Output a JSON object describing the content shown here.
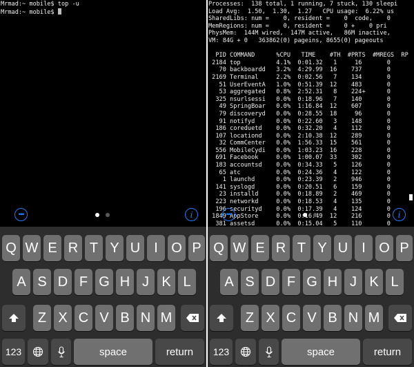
{
  "left": {
    "lines": [
      "Mrmad:~ mobile$ top -u",
      "Mrmad:~ mobile$ "
    ]
  },
  "right": {
    "header": [
      "Processes:  138 total, 1 running, 7 stuck, 130 sleepi",
      "Load Avg:  1.50,  1.30,  1.27   CPU usage:  6.22% us",
      "SharedLibs: num =    0, resident =    0  code,    0",
      "MemRegions: num =    0, resident =    0 +    0 pri",
      "PhysMem:  144M wired,  147M active,   86M inactive,",
      "VM: 84G + 0   363862(0) pageins, 8655(0) pageouts"
    ],
    "table_header": "  PID COMMAND      %CPU   TIME    #TH  #PRTS  #MREGS  RP",
    "rows": [
      " 2184 top          4.1%  0:01.32   1     16       0",
      "   70 backboardd   3.2%  4:29.99  16    737       0",
      " 2169 Terminal     2.2%  0:02.56   7    134       0",
      "   51 UserEventA   1.0%  0:51.39  12    483       0",
      "   53 aggregated   0.8%  2:52.31   8    224+      0",
      "  325 nsurlsessi   0.0%  0:18.96   7    140       0",
      "   49 SpringBoar   0.0%  1:16.84  12    607       0",
      "   79 discoveryd   0.0%  0:28.55  18     96       0",
      "   91 notifyd      0.0%  0:22.60   3    148       0",
      "  186 coreduetd    0.0%  0:32.20   4    112       0",
      "  107 locationd    0.0%  2:10.38  12    289       0",
      "   32 CommCenter   0.0%  1:56.33  15    561       0",
      "  556 MobileCydi   0.0%  1:03.23  16    228       0",
      "  691 Facebook     0.0%  1:00.07  33    302       0",
      "  183 accountsd    0.0%  0:34.33   5    126       0",
      "   65 atc          0.0%  0:24.36   4    122       0",
      "    1 launchd      0.0%  0:23.39   2    946       0",
      "  141 syslogd      0.0%  0:20.51   6    159       0",
      "   23 installd     0.0%  0:18.89   2    469       0",
      "  223 networkd     0.0%  0:18.53   4    135       0",
      "  196 securityd    0.0%  0:17.39   4    124       0",
      " 1849 AppStore     0.0%  0:16.49  12    216       0",
      "  381 assetsd      0.0%  0:15.04   5    110       0"
    ]
  },
  "toolbar": {
    "keyboard_icon": "keyboard-icon",
    "info_label": "i",
    "info_icon": "info-icon"
  },
  "page_indicator": {
    "pages": 2,
    "current": 1
  },
  "keyboard": {
    "row1": [
      "Q",
      "W",
      "E",
      "R",
      "T",
      "Y",
      "U",
      "I",
      "O",
      "P"
    ],
    "row2": [
      "A",
      "S",
      "D",
      "F",
      "G",
      "H",
      "J",
      "K",
      "L"
    ],
    "row3": [
      "Z",
      "X",
      "C",
      "V",
      "B",
      "N",
      "M"
    ],
    "shift_icon": "shift-icon",
    "delete_icon": "delete-icon",
    "numbers_label": "123",
    "globe_icon": "globe-icon",
    "mic_icon": "microphone-icon",
    "space_label": "space",
    "return_label": "return"
  }
}
